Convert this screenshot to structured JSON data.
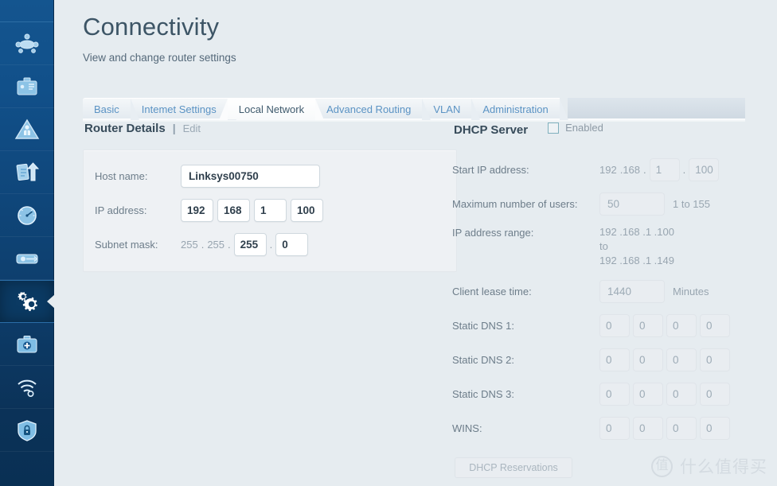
{
  "sidebar": {
    "items": [
      {
        "name": "network-map-icon",
        "label": "Network Map"
      },
      {
        "name": "guest-access-icon",
        "label": "Guest Access"
      },
      {
        "name": "parental-controls-icon",
        "label": "Parental Controls"
      },
      {
        "name": "media-prioritization-icon",
        "label": "Media Prioritization"
      },
      {
        "name": "speed-test-icon",
        "label": "Speed Test"
      },
      {
        "name": "external-storage-icon",
        "label": "External Storage"
      },
      {
        "name": "connectivity-gears-icon",
        "label": "Connectivity"
      },
      {
        "name": "troubleshooting-icon",
        "label": "Troubleshooting"
      },
      {
        "name": "wireless-icon",
        "label": "Wireless"
      },
      {
        "name": "security-shield-icon",
        "label": "Security"
      }
    ],
    "active_index": 6
  },
  "header": {
    "title": "Connectivity",
    "subtitle": "View and change router settings"
  },
  "tabs": [
    {
      "label": "Basic",
      "active": false
    },
    {
      "label": "Intemet Settings",
      "active": false
    },
    {
      "label": "Local Network",
      "active": true
    },
    {
      "label": "Advanced Routing",
      "active": false
    },
    {
      "label": "VLAN",
      "active": false
    },
    {
      "label": "Administration",
      "active": false
    }
  ],
  "router_details": {
    "title": "Router Details",
    "divider": "|",
    "edit_label": "Edit",
    "host_name": {
      "label": "Host name:",
      "value": "Linksys00750",
      "placeholder": "Host name"
    },
    "ip_address": {
      "label": "IP address:",
      "octets": [
        "192",
        "168",
        "1",
        "100"
      ]
    },
    "subnet_mask": {
      "label": "Subnet mask:",
      "static_octets": [
        "255",
        "255"
      ],
      "editable_octets": [
        "255",
        "0"
      ],
      "separator": "."
    }
  },
  "dhcp_server": {
    "title": "DHCP Server",
    "enabled_label": "Enabled",
    "enabled_checked": false,
    "start_ip": {
      "label": "Start IP address:",
      "static_prefix": [
        "192",
        ".168",
        "."
      ],
      "octet3": "1",
      "separator": ".",
      "octet4": "100"
    },
    "max_users": {
      "label": "Maximum number of users:",
      "value": "50",
      "hint": "1 to 155"
    },
    "ip_range": {
      "label": "IP address range:",
      "from": "192 .168 .1 .100",
      "to_word": "to",
      "to": "192 .168 .1 .149"
    },
    "lease_time": {
      "label": "Client lease time:",
      "value": "1440",
      "unit": "Minutes"
    },
    "static_dns_1": {
      "label": "Static DNS 1:",
      "octets": [
        "0",
        "0",
        "0",
        "0"
      ]
    },
    "static_dns_2": {
      "label": "Static DNS 2:",
      "octets": [
        "0",
        "0",
        "0",
        "0"
      ]
    },
    "static_dns_3": {
      "label": "Static DNS 3:",
      "octets": [
        "0",
        "0",
        "0",
        "0"
      ]
    },
    "wins": {
      "label": "WINS:",
      "octets": [
        "0",
        "0",
        "0",
        "0"
      ]
    },
    "reservations_button": "DHCP Reservations"
  },
  "watermark": {
    "logo_char": "值",
    "text": "什么值得买"
  },
  "colors": {
    "sidebar_top": "#14558f",
    "sidebar_bottom": "#093054",
    "accent_tab": "#5b93c4",
    "page_bg": "#e6ecf0",
    "title": "#3d5566"
  }
}
